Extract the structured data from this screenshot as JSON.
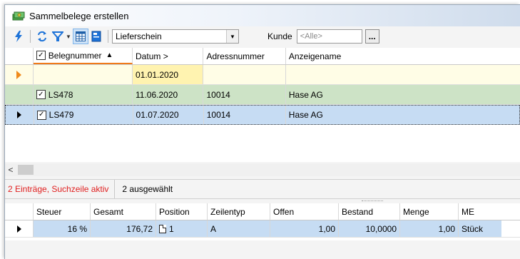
{
  "window": {
    "title": "Sammelbelege erstellen"
  },
  "toolbar": {
    "icons": [
      "lightning-icon",
      "refresh-icon",
      "filter-icon",
      "chevron-down-icon",
      "grid-view-icon",
      "document-icon"
    ],
    "belegart_value": "Lieferschein",
    "kunde_label": "Kunde",
    "kunde_value": "<Alle>",
    "ellipsis_label": "..."
  },
  "grid": {
    "columns": [
      "Belegnummer",
      "Datum >",
      "Adressnummer",
      "Anzeigename"
    ],
    "sort_indicator": "▲",
    "filter_row": {
      "belegnummer": "",
      "datum": "01.01.2020",
      "adressnummer": "",
      "anzeigename": ""
    },
    "rows": [
      {
        "belegnummer": "LS478",
        "datum": "11.06.2020",
        "adressnummer": "10014",
        "anzeigename": "Hase AG",
        "checked": true
      },
      {
        "belegnummer": "LS479",
        "datum": "01.07.2020",
        "adressnummer": "10014",
        "anzeigename": "Hase AG",
        "checked": true
      }
    ]
  },
  "status": {
    "info": "2 Einträge, Suchzeile aktiv",
    "selected": "2 ausgewählt"
  },
  "detail": {
    "columns": [
      "Steuer",
      "Gesamt",
      "Position",
      "Zeilentyp",
      "Offen",
      "Bestand",
      "Menge",
      "ME"
    ],
    "rows": [
      {
        "steuer": "16 %",
        "gesamt": "176,72",
        "position": "1",
        "zeilentyp": "A",
        "offen": "1,00",
        "bestand": "10,0000",
        "menge": "1,00",
        "me": "Stück"
      }
    ]
  },
  "colors": {
    "filter_row_bg": "#fffde6",
    "row_green": "#cde3c6",
    "row_blue": "#c6dcf3",
    "status_red": "#e02020",
    "sort_underline": "#f07a1a"
  }
}
